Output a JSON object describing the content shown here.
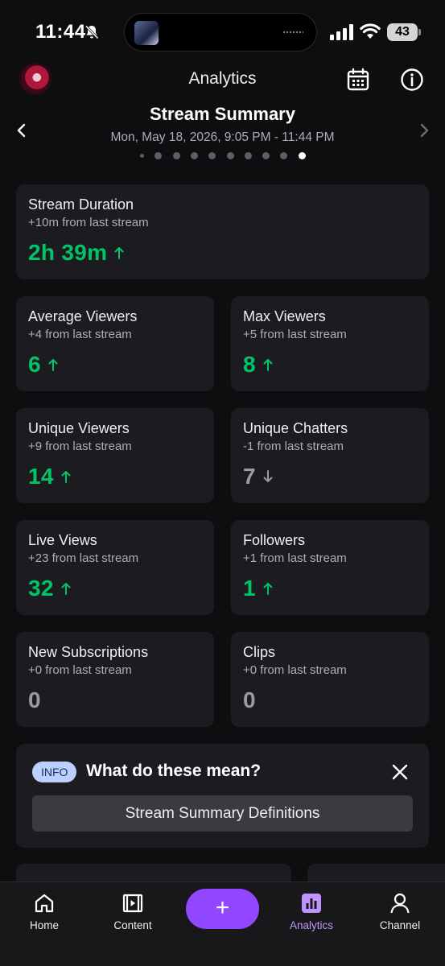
{
  "status_bar": {
    "time": "11:44",
    "battery": "43"
  },
  "header": {
    "title": "Analytics"
  },
  "summary": {
    "title": "Stream Summary",
    "date_range": "Mon, May 18, 2026, 9:05 PM - 11:44 PM",
    "page_count": 10,
    "active_page": 10
  },
  "stats": {
    "stream_duration": {
      "label": "Stream Duration",
      "delta": "+10m from last stream",
      "value": "2h 39m",
      "trend": "up"
    },
    "average_viewers": {
      "label": "Average Viewers",
      "delta": "+4 from last stream",
      "value": "6",
      "trend": "up"
    },
    "max_viewers": {
      "label": "Max Viewers",
      "delta": "+5 from last stream",
      "value": "8",
      "trend": "up"
    },
    "unique_viewers": {
      "label": "Unique Viewers",
      "delta": "+9 from last stream",
      "value": "14",
      "trend": "up"
    },
    "unique_chatters": {
      "label": "Unique Chatters",
      "delta": "-1 from last stream",
      "value": "7",
      "trend": "down"
    },
    "live_views": {
      "label": "Live Views",
      "delta": "+23 from last stream",
      "value": "32",
      "trend": "up"
    },
    "followers": {
      "label": "Followers",
      "delta": "+1 from last stream",
      "value": "1",
      "trend": "up"
    },
    "new_subscriptions": {
      "label": "New Subscriptions",
      "delta": "+0 from last stream",
      "value": "0",
      "trend": "none"
    },
    "clips": {
      "label": "Clips",
      "delta": "+0 from last stream",
      "value": "0",
      "trend": "none"
    }
  },
  "info_box": {
    "badge": "INFO",
    "question": "What do these mean?",
    "button_label": "Stream Summary Definitions"
  },
  "tab_bar": {
    "home": "Home",
    "content": "Content",
    "create": "+",
    "analytics": "Analytics",
    "channel": "Channel",
    "active": "analytics"
  },
  "colors": {
    "background": "#0e0e10",
    "card": "#1c1c20",
    "positive": "#00c567",
    "neutral": "#9a9aa4",
    "accent": "#9147ff",
    "accent_light": "#bf94ff",
    "info_badge": "#bcd0ff"
  }
}
